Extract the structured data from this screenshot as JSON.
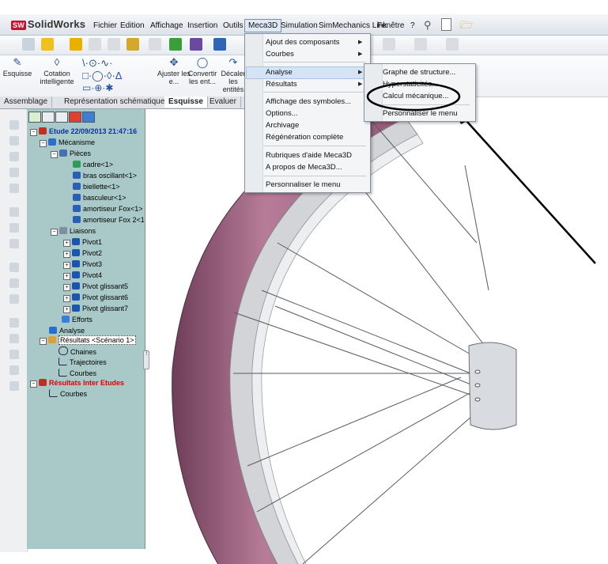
{
  "app": {
    "logo_text": "SolidWorks",
    "logo_badge": "SW"
  },
  "menubar": {
    "items": [
      "Fichier",
      "Edition",
      "Affichage",
      "Insertion",
      "Outils",
      "Meca3D",
      "Simulation",
      "SimMechanics Link",
      "Fenêtre",
      "?"
    ]
  },
  "toolbar": {
    "tools": [
      "Esquisse",
      "Cotation intelligente",
      "Ajuster les e...",
      "Convertir les ent...",
      "Décaler les entités"
    ]
  },
  "tabs": [
    "Assemblage",
    "Représentation schématique",
    "Esquisse",
    "Evaluer"
  ],
  "tree": {
    "root": "Etude 22/09/2013 21:47:16",
    "mecanisme": "Mécanisme",
    "pieces": "Pièces",
    "parts": [
      "cadre<1>",
      "bras oscillant<1>",
      "biellette<1>",
      "basculeur<1>",
      "amortiseur Fox<1>",
      "amortiseur Fox 2<1>"
    ],
    "liaisons": "Liaisons",
    "joints": [
      "Pivot1",
      "Pivot2",
      "Pivot3",
      "Pivot4",
      "Pivot glissant5",
      "Pivot glissant6",
      "Pivot glissant7"
    ],
    "efforts": "Efforts",
    "analyse": "Analyse",
    "resultats": "Résultats <Scénario 1>",
    "chaines": "Chaines",
    "trajectoires": "Trajectoires",
    "courbes": "Courbes",
    "inter": "Résultats Inter Etudes",
    "inter_courbes": "Courbes"
  },
  "meca3d_menu": {
    "items": [
      "Ajout des composants",
      "Courbes",
      "Analyse",
      "Résultats",
      "Affichage des symboles...",
      "Options...",
      "Archivage",
      "Régénération complète",
      "Rubriques d'aide Meca3D",
      "A propos de Meca3D...",
      "Personnaliser le menu"
    ]
  },
  "analyse_submenu": {
    "items": [
      "Graphe de structure...",
      "Hyperstaticités...",
      "Calcul mécanique...",
      "Personnaliser le menu"
    ]
  },
  "colors": {
    "accent": "#0b2fa8",
    "highlight": "#d5e4f5",
    "panel": "#a8c9c8",
    "tire": "#a86a86",
    "alert": "#e00000"
  }
}
